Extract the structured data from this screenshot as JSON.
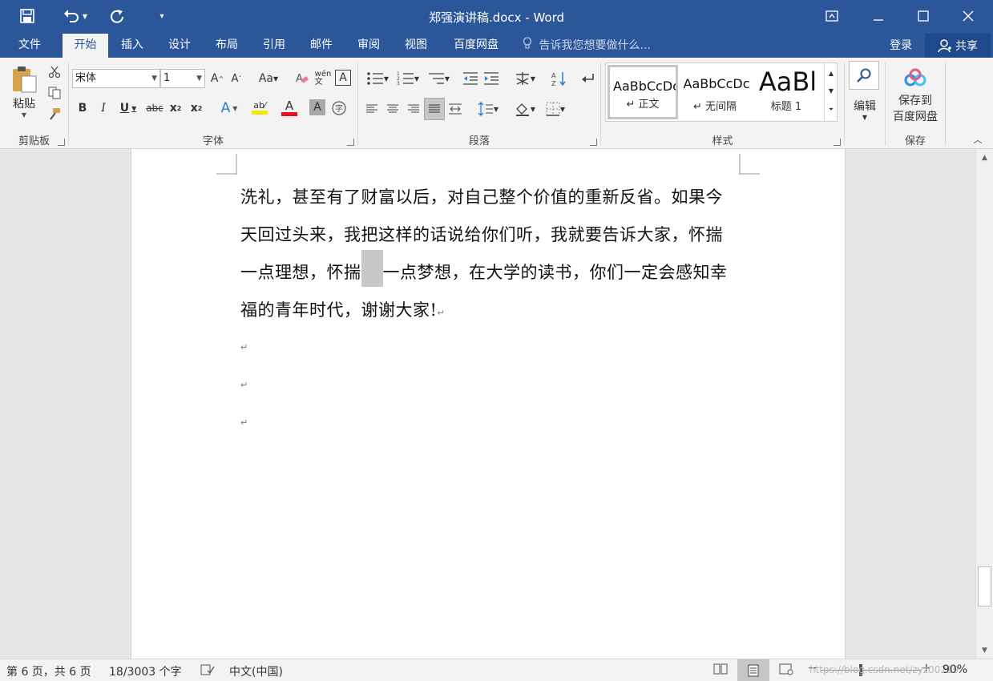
{
  "window": {
    "title": "郑强演讲稿.docx - Word",
    "quick_access": [
      "save-icon",
      "undo-icon",
      "redo-icon",
      "customize-icon"
    ]
  },
  "menu": {
    "tabs": [
      "文件",
      "开始",
      "插入",
      "设计",
      "布局",
      "引用",
      "邮件",
      "审阅",
      "视图",
      "百度网盘"
    ],
    "active_tab": "开始",
    "tell_me": "告诉我您想要做什么...",
    "login": "登录",
    "share": "共享"
  },
  "ribbon": {
    "clipboard": {
      "label": "剪贴板",
      "paste": "粘贴"
    },
    "font": {
      "label": "字体",
      "font_name": "宋体",
      "font_size": "1",
      "font_color": "#e81123",
      "highlight_color": "#f5e600"
    },
    "paragraph": {
      "label": "段落"
    },
    "styles": {
      "label": "样式",
      "items": [
        {
          "sample": "AaBbCcDc",
          "name": "↵ 正文"
        },
        {
          "sample": "AaBbCcDc",
          "name": "↵ 无间隔"
        },
        {
          "sample": "AaBl",
          "name": "标题 1"
        }
      ]
    },
    "editing": {
      "label": "编辑"
    },
    "save": {
      "label": "保存",
      "button_line1": "保存到",
      "button_line2": "百度网盘"
    }
  },
  "document": {
    "lines": [
      "洗礼，甚至有了财富以后，对自己整个价值的重新反省。如果今",
      "天回过头来，我把这样的话说给你们听，我就要告诉大家，怀揣",
      "一点理想，怀揣",
      "一点梦想，在大学的读书，你们一定会感知幸",
      "福的青年时代，谢谢大家!"
    ],
    "paragraph_mark": "↵"
  },
  "status": {
    "page": "第 6 页，共 6 页",
    "words": "18/3003 个字",
    "language": "中文(中国)",
    "zoom": "90%",
    "watermark": "https://blog.csdn.net/zyz00219"
  }
}
